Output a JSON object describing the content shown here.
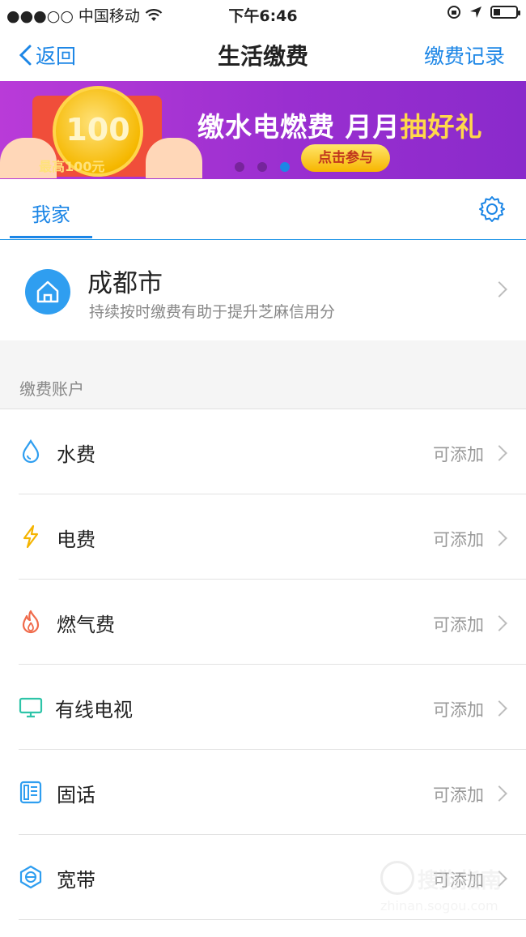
{
  "status_bar": {
    "carrier": "●●●○○ 中国移动",
    "time": "下午6:46"
  },
  "nav": {
    "back_label": "返回",
    "title": "生活缴费",
    "record_label": "缴费记录"
  },
  "banner": {
    "coin_text": "100",
    "coin_sub": "最高100元",
    "headline_main": "缴水电燃费 月月",
    "headline_highlight": "抽好礼",
    "cta": "点击参与",
    "page_count": 3,
    "active_page": 3
  },
  "tabs": {
    "active_label": "我家"
  },
  "home": {
    "city": "成都市",
    "description": "持续按时缴费有助于提升芝麻信用分"
  },
  "section": {
    "title": "缴费账户"
  },
  "accounts": [
    {
      "label": "水费",
      "status": "可添加",
      "icon": "water-drop-icon",
      "color": "#2f9ef0"
    },
    {
      "label": "电费",
      "status": "可添加",
      "icon": "lightning-icon",
      "color": "#f5b400"
    },
    {
      "label": "燃气费",
      "status": "可添加",
      "icon": "flame-icon",
      "color": "#f06a4a"
    },
    {
      "label": "有线电视",
      "status": "可添加",
      "icon": "tv-icon",
      "color": "#2ec4a8"
    },
    {
      "label": "固话",
      "status": "可添加",
      "icon": "phone-icon",
      "color": "#2f9ef0"
    },
    {
      "label": "宽带",
      "status": "可添加",
      "icon": "broadband-icon",
      "color": "#2f9ef0"
    }
  ],
  "watermark": {
    "text1": "搜狗指南",
    "text2": "zhinan.sogou.com"
  }
}
